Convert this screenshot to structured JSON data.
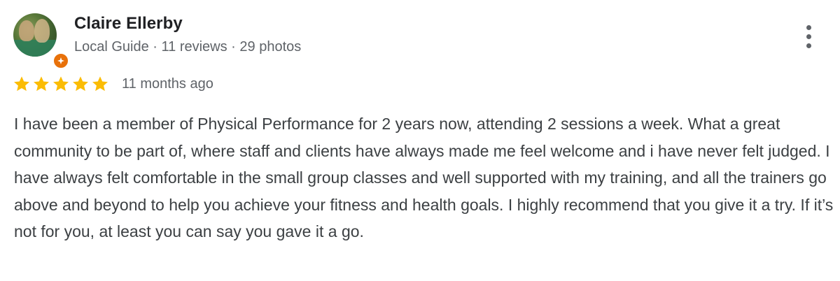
{
  "reviewer": {
    "name": "Claire Ellerby",
    "meta": "Local Guide · 11 reviews · 29 photos",
    "badge_icon": "local-guide-star-icon"
  },
  "review": {
    "stars": 5,
    "star_color": "#fbbc04",
    "time": "11 months ago",
    "text": "I have been a member of Physical Performance for 2 years now, attending 2 sessions a week. What a great community to be part of, where staff and clients have always made me feel welcome and i have never felt judged. I have always felt comfortable in the small group classes and well supported with my training, and all the trainers go above and beyond to help you achieve your fitness and health goals. I highly recommend that you give it a try. If it’s not for you, at least you can say you gave it a go."
  },
  "actions": {
    "more_icon": "more-vert-icon"
  },
  "colors": {
    "badge": "#e8710a",
    "name": "#202124",
    "meta": "#5f6368",
    "body": "#3c4043"
  }
}
